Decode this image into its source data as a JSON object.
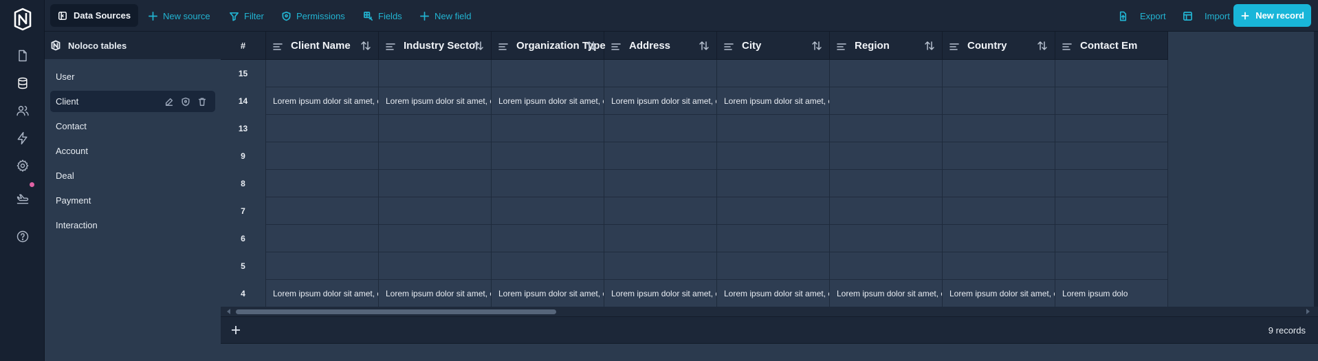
{
  "topbar": {
    "data_sources": "Data Sources",
    "new_source": "New source",
    "filter": "Filter",
    "permissions": "Permissions",
    "fields": "Fields",
    "new_field": "New field",
    "export": "Export",
    "import": "Import",
    "new_record": "New record"
  },
  "panel": {
    "title": "Noloco tables",
    "items": [
      {
        "label": "User"
      },
      {
        "label": "Client"
      },
      {
        "label": "Contact"
      },
      {
        "label": "Account"
      },
      {
        "label": "Deal"
      },
      {
        "label": "Payment"
      },
      {
        "label": "Interaction"
      }
    ],
    "active": "Client"
  },
  "grid": {
    "columns": [
      {
        "label": "#"
      },
      {
        "label": "Client Name"
      },
      {
        "label": "Industry Sector"
      },
      {
        "label": "Organization Type"
      },
      {
        "label": "Address"
      },
      {
        "label": "City"
      },
      {
        "label": "Region"
      },
      {
        "label": "Country"
      },
      {
        "label": "Contact Em"
      }
    ],
    "rows": [
      {
        "id": "15",
        "cells": [
          "",
          "",
          "",
          "",
          "",
          "",
          "",
          ""
        ]
      },
      {
        "id": "14",
        "cells": [
          "Lorem ipsum dolor sit amet, cor",
          "Lorem ipsum dolor sit amet, cor",
          "Lorem ipsum dolor sit amet, cor",
          "Lorem ipsum dolor sit amet, cor",
          "Lorem ipsum dolor sit amet, cor",
          "",
          "",
          ""
        ]
      },
      {
        "id": "13",
        "cells": [
          "",
          "",
          "",
          "",
          "",
          "",
          "",
          ""
        ]
      },
      {
        "id": "9",
        "cells": [
          "",
          "",
          "",
          "",
          "",
          "",
          "",
          ""
        ]
      },
      {
        "id": "8",
        "cells": [
          "",
          "",
          "",
          "",
          "",
          "",
          "",
          ""
        ]
      },
      {
        "id": "7",
        "cells": [
          "",
          "",
          "",
          "",
          "",
          "",
          "",
          ""
        ]
      },
      {
        "id": "6",
        "cells": [
          "",
          "",
          "",
          "",
          "",
          "",
          "",
          ""
        ]
      },
      {
        "id": "5",
        "cells": [
          "",
          "",
          "",
          "",
          "",
          "",
          "",
          ""
        ]
      },
      {
        "id": "4",
        "cells": [
          "Lorem ipsum dolor sit amet, cor",
          "Lorem ipsum dolor sit amet, cor",
          "Lorem ipsum dolor sit amet, cor",
          "Lorem ipsum dolor sit amet, cor",
          "Lorem ipsum dolor sit amet, cor",
          "Lorem ipsum dolor sit amet, cor",
          "Lorem ipsum dolor sit amet, cor",
          "Lorem ipsum dolo"
        ]
      }
    ],
    "record_count": "9 records"
  },
  "colors": {
    "accent": "#19b6d9",
    "notification_dot": "#e062a4"
  },
  "icons": {
    "rail": [
      "noloco-logo-icon",
      "document-icon",
      "database-icon",
      "users-icon",
      "lightning-icon",
      "gear-icon",
      "plane-icon",
      "help-icon"
    ]
  }
}
